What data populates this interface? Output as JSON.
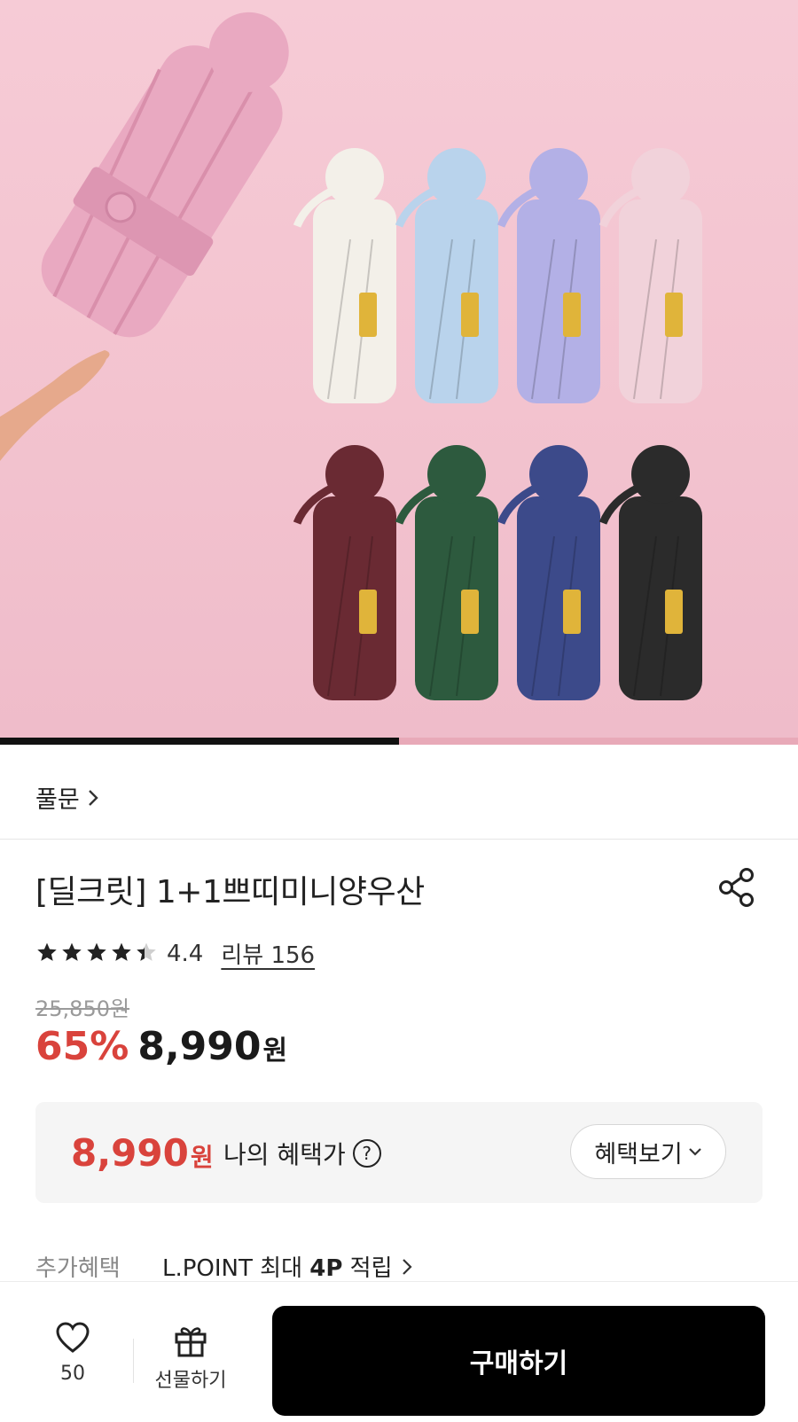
{
  "gallery": {
    "progress_fraction": 0.5,
    "umbrella_colors": [
      "#f3f0e9",
      "#b9d3ec",
      "#b3b0e6",
      "#f1d2da",
      "#6a2a33",
      "#2d5a3e",
      "#3c4a8a",
      "#2b2b2b"
    ],
    "featured_color": "#e9a9c1"
  },
  "store": {
    "name": "풀문"
  },
  "product": {
    "title": "[딜크릿] 1+1쁘띠미니양우산"
  },
  "rating": {
    "score": 4.4,
    "score_text": "4.4",
    "review_text": "리뷰 156"
  },
  "price": {
    "original": "25,850원",
    "discount": "65%",
    "sale": "8,990",
    "currency": "원"
  },
  "benefit": {
    "price": "8,990",
    "currency": "원",
    "label": "나의 혜택가",
    "button_label": "혜택보기"
  },
  "extra_benefit": {
    "label": "추가혜택",
    "prefix": "L.POINT 최대 ",
    "points": "4P",
    "suffix": " 적립"
  },
  "bottom_bar": {
    "like_count": "50",
    "gift_label": "선물하기",
    "buy_label": "구매하기"
  },
  "colors": {
    "accent_red": "#d9433c",
    "buy_button": "#000000"
  }
}
